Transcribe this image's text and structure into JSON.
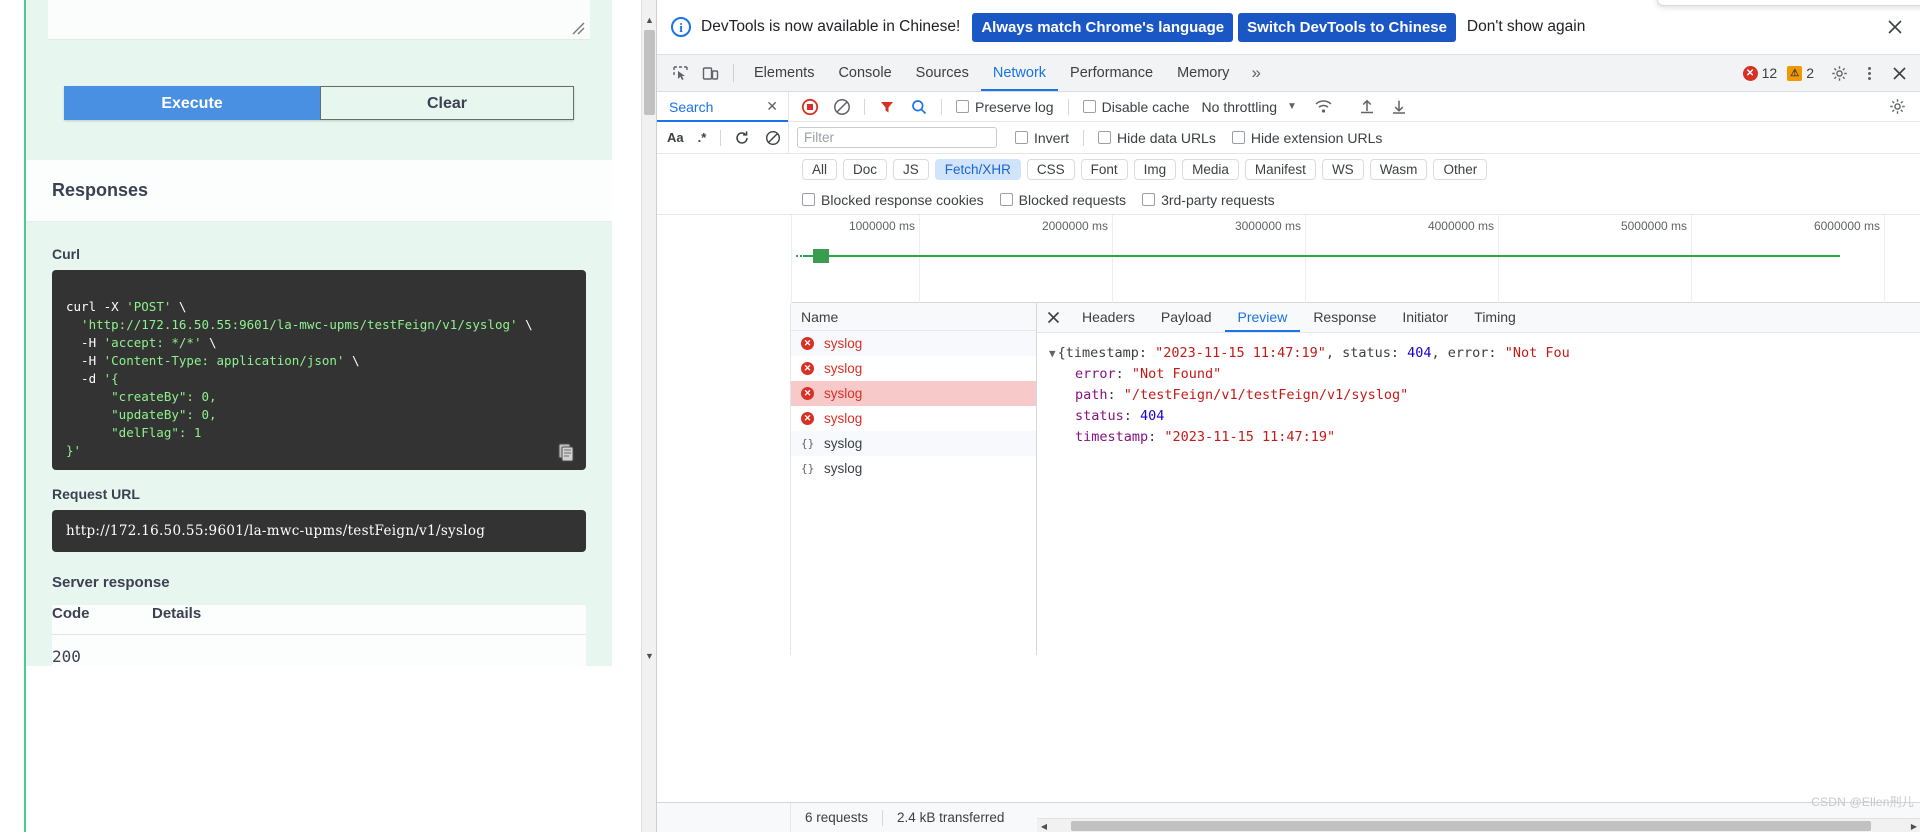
{
  "swagger": {
    "execute_label": "Execute",
    "clear_label": "Clear",
    "responses_heading": "Responses",
    "curl_label": "Curl",
    "curl_lines": [
      "curl -X 'POST' \\",
      "  'http://172.16.50.55:9601/la-mwc-upms/testFeign/v1/syslog' \\",
      "  -H 'accept: */*' \\",
      "  -H 'Content-Type: application/json' \\",
      "  -d '{",
      "      \"createBy\": 0,",
      "      \"updateBy\": 0,",
      "      \"delFlag\": 1",
      "}'"
    ],
    "request_url_label": "Request URL",
    "request_url_value": "http://172.16.50.55:9601/la-mwc-upms/testFeign/v1/syslog",
    "server_response_label": "Server response",
    "table_headers": {
      "code": "Code",
      "details": "Details"
    },
    "response_code": "200",
    "copy_icon": "clipboard-icon"
  },
  "devtools": {
    "notice": {
      "icon": "info-icon",
      "message": "DevTools is now available in Chinese!",
      "primary_btn": "Always match Chrome's language",
      "secondary_btn": "Switch DevTools to Chinese",
      "dismiss_link": "Don't show again",
      "close_icon": "close-icon"
    },
    "tabs": [
      {
        "label": "Elements",
        "active": false
      },
      {
        "label": "Console",
        "active": false
      },
      {
        "label": "Sources",
        "active": false
      },
      {
        "label": "Network",
        "active": true
      },
      {
        "label": "Performance",
        "active": false
      },
      {
        "label": "Memory",
        "active": false
      }
    ],
    "more_tabs_icon": "chevron-double-right-icon",
    "inspect_icon": "inspect-element-icon",
    "device_icon": "device-toolbar-icon",
    "errors_count": "12",
    "warnings_count": "2",
    "settings_icon": "gear-icon",
    "kebab_icon": "more-vertical-icon",
    "panel_close_icon": "close-icon",
    "network": {
      "search_tab_label": "Search",
      "search_close_icon": "close-icon",
      "record_icon": "record-stop-icon",
      "clear_icon": "clear-icon",
      "filter_icon": "funnel-icon",
      "search_icon": "search-icon",
      "preserve_log_label": "Preserve log",
      "disable_cache_label": "Disable cache",
      "throttling_label": "No throttling",
      "throttle_caret": "chevron-down-icon",
      "wifi_icon": "network-conditions-icon",
      "import_icon": "import-har-icon",
      "export_icon": "export-har-icon",
      "settings_icon": "gear-icon",
      "match_case_label": "Aa",
      "regex_label": ".*",
      "refresh_icon": "refresh-icon",
      "clear2_icon": "clear-icon",
      "filter_placeholder": "Filter",
      "filter_value": "",
      "invert_label": "Invert",
      "hide_data_urls_label": "Hide data URLs",
      "hide_extension_urls_label": "Hide extension URLs",
      "type_filters": [
        {
          "label": "All",
          "selected": false
        },
        {
          "label": "Doc",
          "selected": false
        },
        {
          "label": "JS",
          "selected": false
        },
        {
          "label": "Fetch/XHR",
          "selected": true
        },
        {
          "label": "CSS",
          "selected": false
        },
        {
          "label": "Font",
          "selected": false
        },
        {
          "label": "Img",
          "selected": false
        },
        {
          "label": "Media",
          "selected": false
        },
        {
          "label": "Manifest",
          "selected": false
        },
        {
          "label": "WS",
          "selected": false
        },
        {
          "label": "Wasm",
          "selected": false
        },
        {
          "label": "Other",
          "selected": false
        }
      ],
      "blocked_response_cookies_label": "Blocked response cookies",
      "blocked_requests_label": "Blocked requests",
      "third_party_requests_label": "3rd-party requests",
      "timeline_ticks": [
        "1000000 ms",
        "2000000 ms",
        "3000000 ms",
        "4000000 ms",
        "5000000 ms",
        "6000000 ms"
      ],
      "name_column_header": "Name",
      "requests": [
        {
          "name": "syslog",
          "status": "error",
          "icon": "error-circle-icon",
          "selected": false
        },
        {
          "name": "syslog",
          "status": "error",
          "icon": "error-circle-icon",
          "selected": false
        },
        {
          "name": "syslog",
          "status": "error",
          "icon": "error-circle-icon",
          "selected": true
        },
        {
          "name": "syslog",
          "status": "error",
          "icon": "error-circle-icon",
          "selected": false
        },
        {
          "name": "syslog",
          "status": "ok",
          "icon": "json-braces-icon",
          "selected": false
        },
        {
          "name": "syslog",
          "status": "ok",
          "icon": "json-braces-icon",
          "selected": false
        }
      ],
      "detail_tabs": [
        {
          "label": "Headers",
          "active": false
        },
        {
          "label": "Payload",
          "active": false
        },
        {
          "label": "Preview",
          "active": true
        },
        {
          "label": "Response",
          "active": false
        },
        {
          "label": "Initiator",
          "active": false
        },
        {
          "label": "Timing",
          "active": false
        }
      ],
      "detail_close_icon": "close-icon",
      "preview": {
        "root_prefix": "{timestamp: ",
        "root_timestamp": "\"2023-11-15 11:47:19\"",
        "root_mid": ", status: ",
        "root_status": "404",
        "root_mid2": ", error: ",
        "root_error": "\"Not Fou",
        "rows": [
          {
            "key": "error",
            "value": "\"Not Found\"",
            "type": "string"
          },
          {
            "key": "path",
            "value": "\"/testFeign/v1/testFeign/v1/syslog\"",
            "type": "string"
          },
          {
            "key": "status",
            "value": "404",
            "type": "number"
          },
          {
            "key": "timestamp",
            "value": "\"2023-11-15 11:47:19\"",
            "type": "string"
          }
        ]
      },
      "status_requests": "6 requests",
      "status_transferred": "2.4 kB transferred"
    }
  },
  "watermark": "CSDN @Ellen刑儿"
}
